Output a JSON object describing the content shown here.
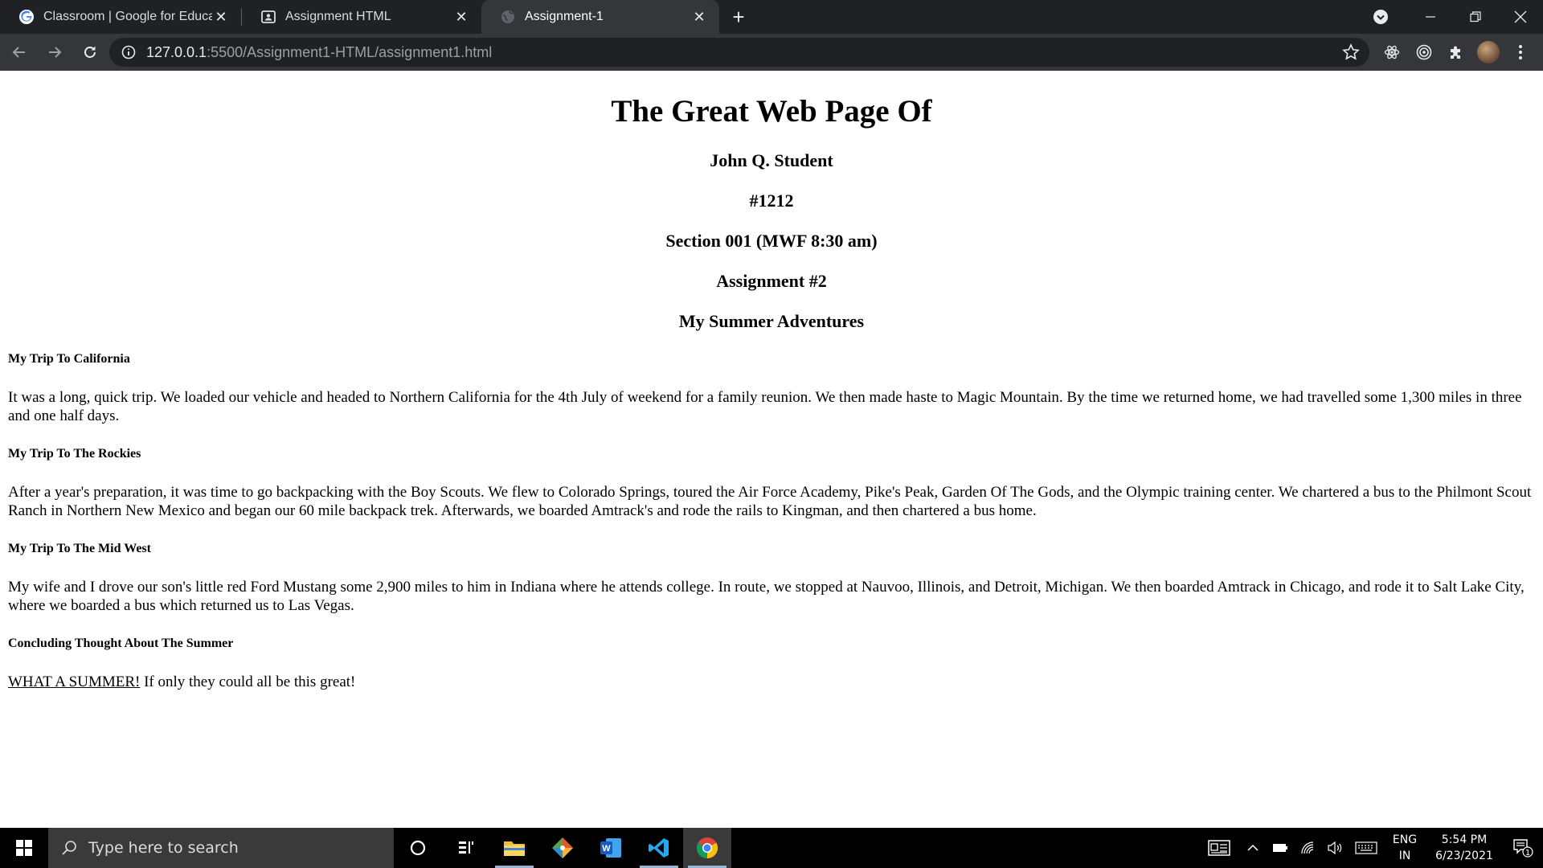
{
  "browser": {
    "tabs": [
      {
        "title": "Classroom | Google for Education",
        "favicon": "google-g-icon",
        "active": false
      },
      {
        "title": "Assignment HTML",
        "favicon": "classroom-assignment-icon",
        "active": false
      },
      {
        "title": "Assignment-1",
        "favicon": "globe-icon",
        "active": true
      }
    ],
    "url": {
      "host": "127.0.0.1",
      "rest": ":5500/Assignment1-HTML/assignment1.html"
    }
  },
  "page": {
    "title": "The Great Web Page Of",
    "author": "John Q. Student",
    "student_id": "#1212",
    "section": "Section 001 (MWF 8:30 am)",
    "assignment": "Assignment #2",
    "subtitle": "My Summer Adventures",
    "sections": [
      {
        "heading": "My Trip To California",
        "text": "It was a long, quick trip. We loaded our vehicle and headed to Northern California for the 4th July of weekend for a family reunion. We then made haste to Magic Mountain. By the time we returned home, we had travelled some 1,300 miles in three and one half days."
      },
      {
        "heading": "My Trip To The Rockies",
        "text": "After a year's preparation, it was time to go backpacking with the Boy Scouts. We flew to Colorado Springs, toured the Air Force Academy, Pike's Peak, Garden Of The Gods, and the Olympic training center. We chartered a bus to the Philmont Scout Ranch in Northern New Mexico and began our 60 mile backpack trek. Afterwards, we boarded Amtrack's and rode the rails to Kingman, and then chartered a bus home."
      },
      {
        "heading": "My Trip To The Mid West",
        "text": "My wife and I drove our son's little red Ford Mustang some 2,900 miles to him in Indiana where he attends college. In route, we stopped at Nauvoo, Illinois, and Detroit, Michigan. We then boarded Amtrack in Chicago, and rode it to Salt Lake City, where we boarded a bus which returned us to Las Vegas."
      }
    ],
    "conclusion": {
      "heading": "Concluding Thought About The Summer",
      "link_text": "WHAT A SUMMER!",
      "text": " If only they could all be this great!"
    }
  },
  "taskbar": {
    "search_placeholder": "Type here to search",
    "apps": [
      "cortana-icon",
      "task-view-icon",
      "file-explorer-icon",
      "git-icon",
      "word-icon",
      "vscode-icon",
      "chrome-icon"
    ],
    "language": "ENG",
    "region": "IN",
    "time": "5:54 PM",
    "date": "6/23/2021",
    "notification_count": "1"
  }
}
